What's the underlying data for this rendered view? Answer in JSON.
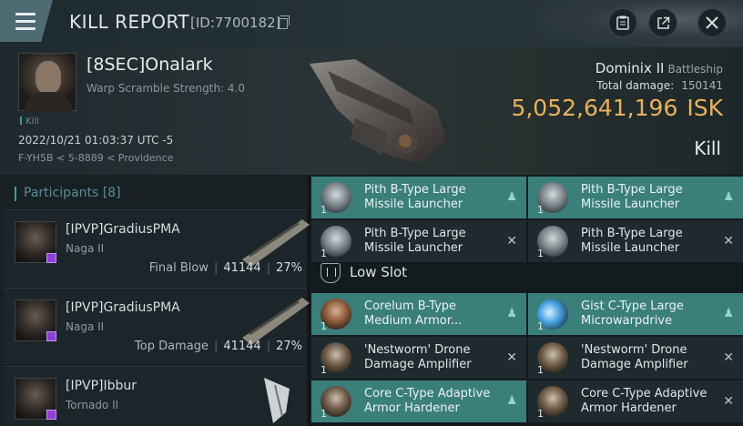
{
  "header": {
    "title": "KILL REPORT",
    "report_id": "[ID:7700182]",
    "icons": [
      "menu-icon",
      "copy-icon",
      "clipboard-icon",
      "external-link-icon",
      "close-icon"
    ]
  },
  "victim": {
    "name": "[8SEC]Onalark",
    "warp_scramble": "Warp Scramble Strength: 4.0",
    "tag": "Kill",
    "date": "2022/10/21 01:03:37 UTC -5",
    "location": "F-YH5B < 5-8889 < Providence",
    "ship_name": "Dominix II",
    "ship_class": "Battleship",
    "total_damage_label": "Total damage:",
    "total_damage": "150141",
    "isk_value": "5,052,641,196",
    "isk_unit": "ISK",
    "result": "Kill"
  },
  "participants": {
    "label": "Participants",
    "count": "[8]",
    "rows": [
      {
        "name": "[IPVP]GradiusPMA",
        "ship": "Naga II",
        "role": "Final Blow",
        "damage": "41144",
        "percent": "27%"
      },
      {
        "name": "[IPVP]GradiusPMA",
        "ship": "Naga II",
        "role": "Top Damage",
        "damage": "41144",
        "percent": "27%"
      },
      {
        "name": "[IPVP]Ibbur",
        "ship": "Tornado II",
        "role": "",
        "damage": "",
        "percent": ""
      }
    ]
  },
  "modules": {
    "low_slot_label": "Low Slot",
    "top": [
      {
        "name": "Pith B-Type Large Missile Launcher",
        "qty": "1",
        "status": "dropped"
      },
      {
        "name": "Pith B-Type Large Missile Launcher",
        "qty": "1",
        "status": "dropped"
      },
      {
        "name": "Pith B-Type Large Missile Launcher",
        "qty": "1",
        "status": "destroyed"
      },
      {
        "name": "Pith B-Type Large Missile Launcher",
        "qty": "1",
        "status": "destroyed"
      }
    ],
    "low": [
      {
        "name": "Corelum B-Type Medium Armor...",
        "qty": "1",
        "status": "dropped"
      },
      {
        "name": "Gist C-Type Large Microwarpdrive",
        "qty": "1",
        "status": "dropped"
      },
      {
        "name": "'Nestworm' Drone Damage Amplifier",
        "qty": "1",
        "status": "destroyed"
      },
      {
        "name": "'Nestworm' Drone Damage Amplifier",
        "qty": "1",
        "status": "destroyed"
      },
      {
        "name": "Core C-Type Adaptive Armor Hardener",
        "qty": "1",
        "status": "dropped"
      },
      {
        "name": "Core C-Type Adaptive Armor Hardener",
        "qty": "1",
        "status": "destroyed"
      }
    ],
    "status_icons": {
      "dropped": "person-icon",
      "destroyed": "x-icon"
    }
  },
  "colors": {
    "accent_teal": "#3b7f7b",
    "isk_gold": "#e8b25c",
    "participants_accent": "#3c9ca8"
  }
}
